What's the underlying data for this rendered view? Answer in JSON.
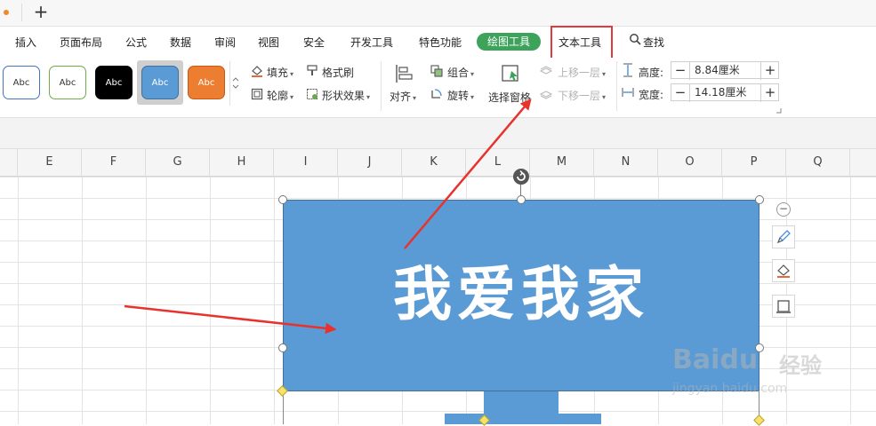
{
  "tabstrip": {
    "new_tab_label": "+"
  },
  "menu": {
    "items": [
      "插入",
      "页面布局",
      "公式",
      "数据",
      "审阅",
      "视图",
      "安全",
      "开发工具",
      "特色功能"
    ],
    "drawing_tools": "绘图工具",
    "text_tools": "文本工具",
    "find": "查找"
  },
  "ribbon": {
    "styles": [
      {
        "label": "Abc",
        "bg": "#ffffff",
        "border": "#4472c4",
        "fg": "#333333"
      },
      {
        "label": "Abc",
        "bg": "#ffffff",
        "border": "#70ad47",
        "fg": "#333333"
      },
      {
        "label": "Abc",
        "bg": "#000000",
        "border": "#000000",
        "fg": "#ffffff"
      },
      {
        "label": "Abc",
        "bg": "#5b9bd5",
        "border": "#41719c",
        "fg": "#ffffff"
      },
      {
        "label": "Abc",
        "bg": "#ed7d31",
        "border": "#c55a11",
        "fg": "#ffffff"
      }
    ],
    "fill": "填充",
    "format_painter": "格式刷",
    "outline": "轮廓",
    "shape_effects": "形状效果",
    "align": "对齐",
    "group": "组合",
    "rotate": "旋转",
    "selection_pane": "选择窗格",
    "bring_forward": "上移一层",
    "send_backward": "下移一层",
    "height_label": "高度:",
    "height_value": "8.84厘米",
    "width_label": "宽度:",
    "width_value": "14.18厘米",
    "minus": "−",
    "plus": "+"
  },
  "sheet": {
    "columns": [
      "E",
      "F",
      "G",
      "H",
      "I",
      "J",
      "K",
      "L",
      "M",
      "N",
      "O",
      "P",
      "Q"
    ]
  },
  "shape": {
    "text": "我爱我家",
    "fill_color": "#5b9bd5"
  },
  "side_toolbar": {
    "collapse": "−"
  },
  "watermark": {
    "logo": "Bai",
    "logo_suffix": "du",
    "cn": "经验",
    "sub": "jingyan.baidu.com"
  },
  "colors": {
    "accent_green": "#3da35a",
    "highlight_red": "#e0393e",
    "arrow_red": "#e8322e"
  }
}
